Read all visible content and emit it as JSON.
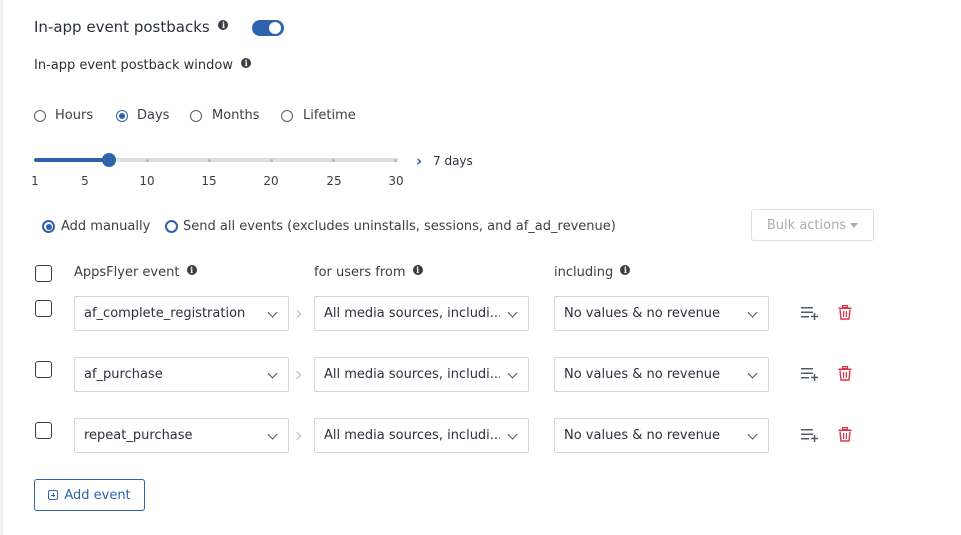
{
  "header": {
    "title": "In-app event postbacks",
    "toggle_on": true,
    "window_label": "In-app event postback window"
  },
  "window_units": {
    "options": [
      "Hours",
      "Days",
      "Months",
      "Lifetime"
    ],
    "selected": "Days"
  },
  "slider": {
    "ticks": [
      "1",
      "5",
      "10",
      "15",
      "20",
      "25",
      "30"
    ],
    "min": 1,
    "max": 30,
    "value": 7,
    "value_label": "7 days"
  },
  "mode": {
    "manual_label": "Add manually",
    "all_label": "Send all events (excludes uninstalls, sessions, and af_ad_revenue)",
    "selected": "manual"
  },
  "bulk_actions": {
    "label": "Bulk actions",
    "enabled": false
  },
  "table": {
    "headers": {
      "event": "AppsFlyer event",
      "users": "for users from",
      "including": "including"
    },
    "rows": [
      {
        "event": "af_complete_registration",
        "users": "All media sources, includi...",
        "including": "No values & no revenue"
      },
      {
        "event": "af_purchase",
        "users": "All media sources, includi...",
        "including": "No values & no revenue"
      },
      {
        "event": "repeat_purchase",
        "users": "All media sources, includi...",
        "including": "No values & no revenue"
      }
    ]
  },
  "add_event": {
    "label": "Add event"
  },
  "colors": {
    "accent": "#2e62ad",
    "danger": "#d8354a",
    "text": "#2b313b",
    "border": "#d3d7dd"
  },
  "icons": {
    "info": "info-icon",
    "add_row": "add-row-icon",
    "delete": "trash-icon",
    "dropdown": "chevron-down-icon",
    "add_event": "plus-square-icon"
  }
}
